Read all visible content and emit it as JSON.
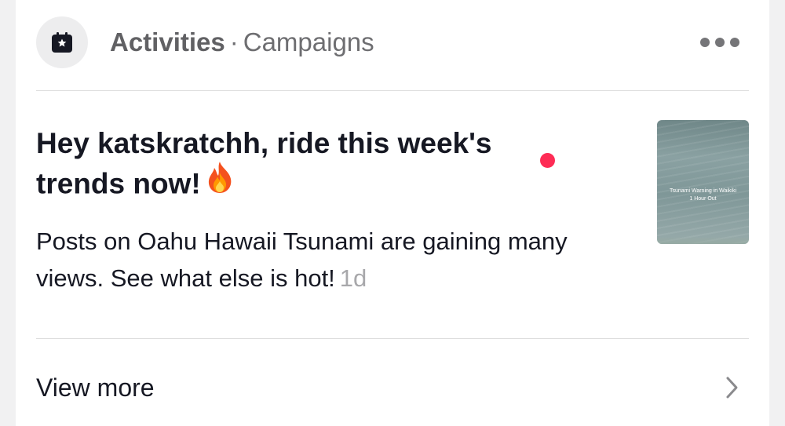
{
  "header": {
    "category": "Activities",
    "separator": "·",
    "subcategory": "Campaigns",
    "icon": "calendar-star-icon",
    "menu_icon": "more-horizontal-icon"
  },
  "notification": {
    "title": "Hey katskratchh, ride this week's trends now!",
    "title_emoji": "fire-emoji",
    "body": "Posts on Oahu Hawaii Tsunami are gaining many views. See what else is hot!",
    "time": "1d",
    "unread": true,
    "thumbnail": {
      "caption_line1": "Tsunami Warning in Waikiki",
      "caption_line2": "1 Hour Out"
    }
  },
  "footer": {
    "view_more_label": "View more",
    "icon": "chevron-right-icon"
  },
  "colors": {
    "unread_dot": "#fe2c55",
    "text_primary": "#161823",
    "text_secondary": "#6e6e71",
    "timestamp": "#a8a8ab"
  }
}
